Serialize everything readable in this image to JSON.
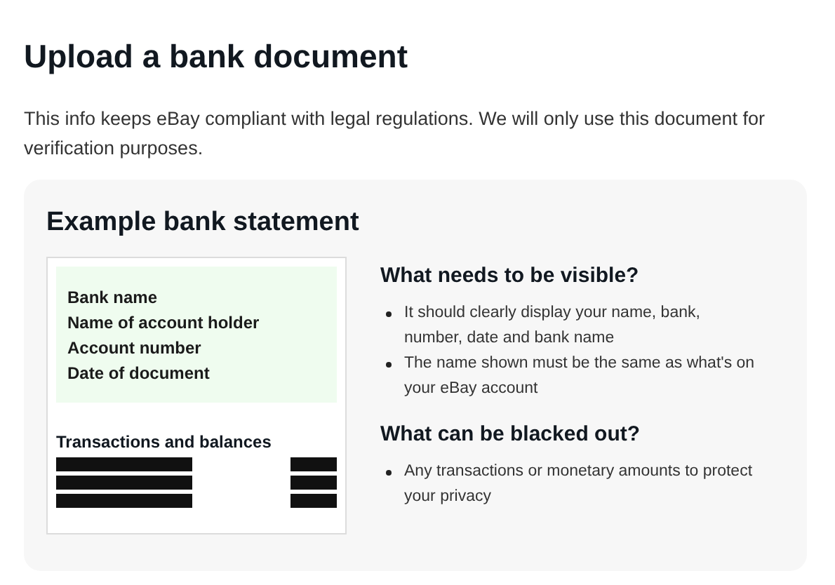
{
  "title": "Upload a bank document",
  "intro": "This info keeps eBay compliant with legal regulations. We will only use this document for verification purposes.",
  "example": {
    "heading": "Example bank statement",
    "document": {
      "fields": [
        "Bank name",
        "Name of account holder",
        "Account number",
        "Date of document"
      ],
      "transactions_heading": "Transactions and balances",
      "rows": [
        {
          "kind": "redacted"
        },
        {
          "kind": "redacted"
        },
        {
          "kind": "redacted"
        }
      ]
    },
    "sections": [
      {
        "heading": "What needs to be visible?",
        "bullets": [
          "It should clearly display your name, bank, number, date and bank name",
          "The name shown must be the same as what's on your eBay account"
        ]
      },
      {
        "heading": "What can be blacked out?",
        "bullets": [
          "Any transactions or monetary amounts to protect your privacy"
        ]
      }
    ]
  }
}
